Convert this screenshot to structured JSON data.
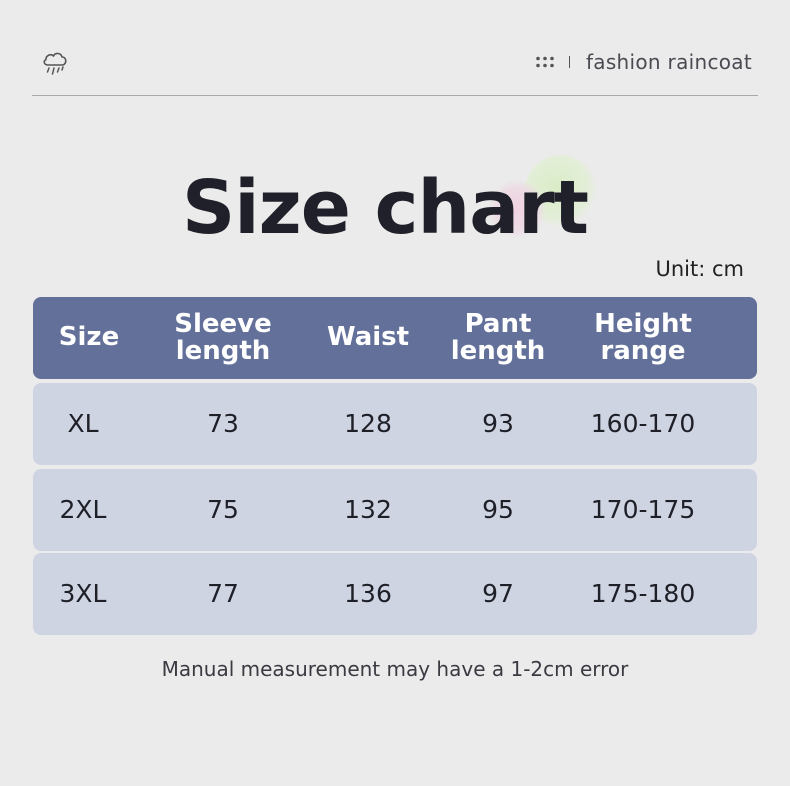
{
  "brand": "fashion raincoat",
  "title": "Size chart",
  "unit": "Unit:  cm",
  "header": {
    "size": "Size",
    "sleeve": "Sleeve length",
    "waist": "Waist",
    "pant": "Pant length",
    "height": "Height range"
  },
  "rows": [
    {
      "size": "XL",
      "sleeve": "73",
      "waist": "128",
      "pant": "93",
      "height": "160-170"
    },
    {
      "size": "2XL",
      "sleeve": "75",
      "waist": "132",
      "pant": "95",
      "height": "170-175"
    },
    {
      "size": "3XL",
      "sleeve": "77",
      "waist": "136",
      "pant": "97",
      "height": "175-180"
    }
  ],
  "note": "Manual measurement may have a 1-2cm error",
  "icons": [
    "rain-cloud-icon",
    "dots-grid-icon"
  ],
  "colors": {
    "header_bg": "#63709a",
    "row_bg": "#cfd4e3",
    "page_bg": "#ebebeb"
  }
}
